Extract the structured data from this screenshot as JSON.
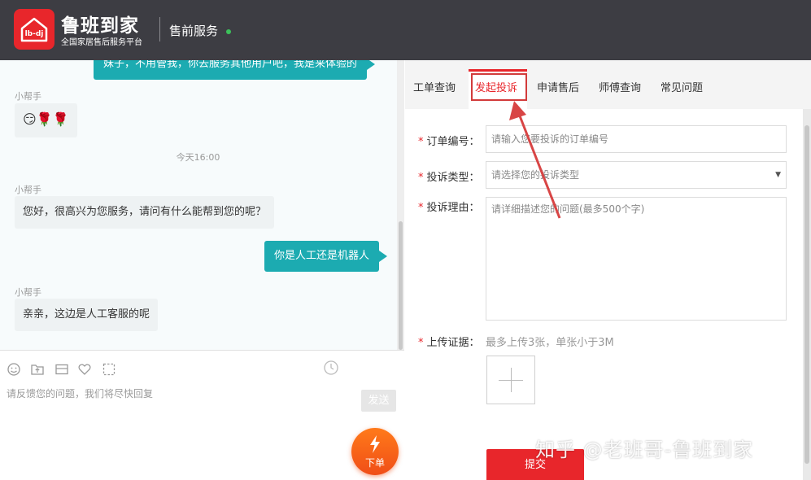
{
  "header": {
    "brand_name": "鲁班到家",
    "brand_subtitle": "全国家居售后服务平台",
    "logo_text": "lb-dj",
    "service_title": "售前服务",
    "colors": {
      "bar": "#3d3d43",
      "logo": "#e8262b",
      "online": "#3cc15a"
    }
  },
  "chat": {
    "messages": [
      {
        "side": "right",
        "text": "妹子，不用管我，你去服务其他用户吧，我是来体验的"
      },
      {
        "side": "left",
        "sender": "小帮手",
        "text": "😏🌹🌹"
      },
      {
        "type": "time",
        "text": "今天16:00"
      },
      {
        "side": "left",
        "sender": "小帮手",
        "text": "您好，很高兴为您服务，请问有什么能帮到您的呢？"
      },
      {
        "side": "right",
        "text": "你是人工还是机器人"
      },
      {
        "side": "left",
        "sender": "小帮手",
        "text": "亲亲，这边是人工客服的呢"
      }
    ],
    "toolbar_icons": [
      "emoji-icon",
      "image-upload-icon",
      "mail-icon",
      "heart-icon",
      "screenshot-icon",
      "history-icon"
    ],
    "input_placeholder": "请反馈您的问题，我们将尽快回复",
    "send_label": "发送",
    "order_label": "下单",
    "colors": {
      "bubble_right": "#1cabb1",
      "bubble_left": "#eef2f3",
      "order": "#f04e17"
    }
  },
  "tabs": [
    {
      "label": "工单查询",
      "active": false
    },
    {
      "label": "发起投诉",
      "active": true
    },
    {
      "label": "申请售后",
      "active": false
    },
    {
      "label": "师傅查询",
      "active": false
    },
    {
      "label": "常见问题",
      "active": false
    }
  ],
  "form": {
    "order_no": {
      "required": "*",
      "label": "订单编号：",
      "placeholder": "请输入您要投诉的订单编号"
    },
    "complaint_type": {
      "required": "*",
      "label": "投诉类型：",
      "selected": "请选择您的投诉类型"
    },
    "reason": {
      "required": "*",
      "label": "投诉理由：",
      "placeholder": "请详细描述您的问题(最多500个字)"
    },
    "evidence": {
      "required": "*",
      "label": "上传证据：",
      "hint": "最多上传3张，单张小于3M"
    },
    "submit_label": "提交",
    "colors": {
      "required": "#e8262b",
      "submit": "#e8262b",
      "highlight": "#d23b3b"
    }
  },
  "watermark": "知乎 @老班哥-鲁班到家"
}
